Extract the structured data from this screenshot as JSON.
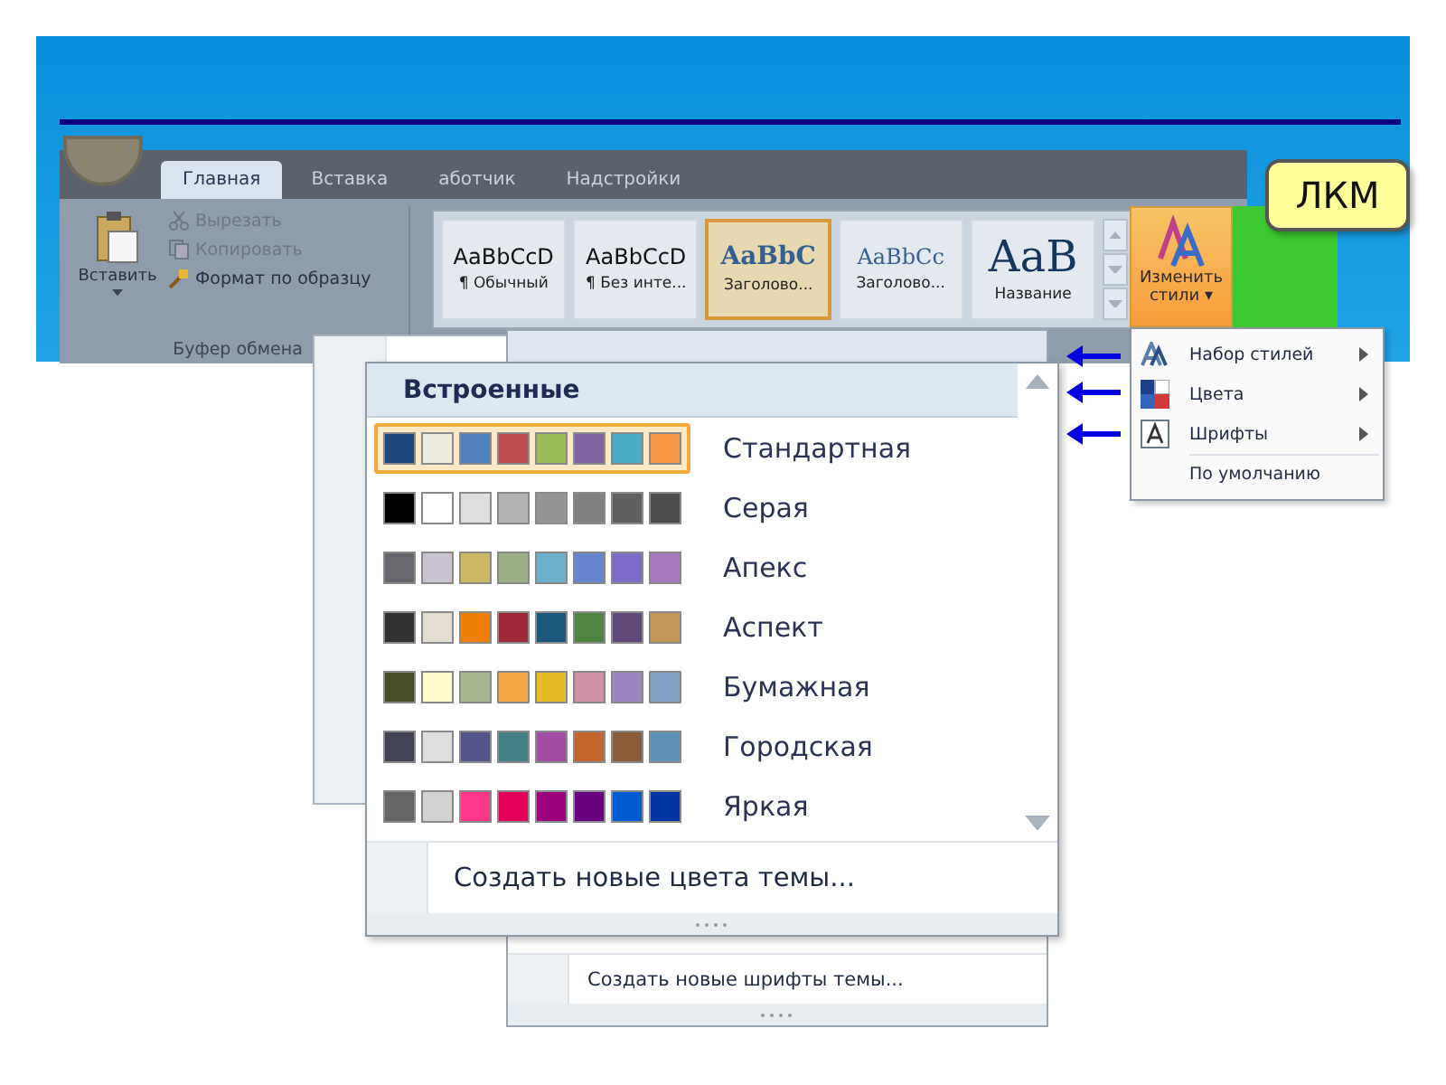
{
  "ribbon": {
    "tabs": [
      {
        "label": "Главная",
        "selected": true
      },
      {
        "label": "Вставка",
        "selected": false
      },
      {
        "label": "аботчик",
        "selected": false
      },
      {
        "label": "Надстройки",
        "selected": false
      }
    ],
    "clipboard": {
      "paste": "Вставить",
      "cut": "Вырезать",
      "copy": "Копировать",
      "format": "Формат по образцу",
      "group": "Буфер обмена"
    },
    "styles": [
      {
        "sample": "AaBbCcD",
        "name": "¶ Обычный",
        "kind": "body",
        "selected": false
      },
      {
        "sample": "AaBbCcD",
        "name": "¶ Без инте...",
        "kind": "body",
        "selected": false
      },
      {
        "sample": "AaBbC",
        "name": "Заголово...",
        "kind": "heading1",
        "selected": true
      },
      {
        "sample": "AaBbCc",
        "name": "Заголово...",
        "kind": "heading2",
        "selected": false
      },
      {
        "sample": "AaB",
        "name": "Название",
        "kind": "title",
        "selected": false
      }
    ],
    "change_styles": {
      "line1": "Изменить",
      "line2": "стили",
      "caret": "▾"
    }
  },
  "callout": "ЛКМ",
  "change_styles_menu": [
    {
      "label": "Набор стилей",
      "submenu": true,
      "kind": "styleset"
    },
    {
      "label": "Цвета",
      "submenu": true,
      "kind": "colors"
    },
    {
      "label": "Шрифты",
      "submenu": true,
      "kind": "fonts"
    },
    {
      "label": "По умолчанию",
      "submenu": false,
      "kind": "plain"
    }
  ],
  "fonts_gallery": {
    "footer": "Создать новые шрифты темы..."
  },
  "colors_gallery": {
    "header": "Встроенные",
    "footer": "Создать новые цвета темы...",
    "schemes": [
      {
        "name": "Стандартная",
        "selected": true,
        "swatches": [
          {
            "color": "#1f497d"
          },
          {
            "color": "#eeece1"
          },
          {
            "color": "#4f81bd"
          },
          {
            "color": "#c0504d"
          },
          {
            "color": "#9bbb59"
          },
          {
            "color": "#8064a2"
          },
          {
            "color": "#4bacc6"
          },
          {
            "color": "#f79646"
          }
        ]
      },
      {
        "name": "Серая",
        "selected": false,
        "swatches": [
          {
            "color": "#000000"
          },
          {
            "color": "#ffffff"
          },
          {
            "color": "#dddddd"
          },
          {
            "color": "#b2b2b2"
          },
          {
            "color": "#969696"
          },
          {
            "color": "#808080"
          },
          {
            "color": "#5f5f5f"
          },
          {
            "color": "#4d4d4d"
          }
        ]
      },
      {
        "name": "Апекс",
        "selected": false,
        "swatches": [
          {
            "color": "#69676d"
          },
          {
            "color": "#c9c2d1"
          },
          {
            "color": "#ceb966"
          },
          {
            "color": "#9cb084"
          },
          {
            "color": "#6bb1c9"
          },
          {
            "color": "#6585cf"
          },
          {
            "color": "#7e6bc9"
          },
          {
            "color": "#a379bb"
          }
        ]
      },
      {
        "name": "Аспект",
        "selected": false,
        "swatches": [
          {
            "color": "#323232"
          },
          {
            "color": "#e3ded1"
          },
          {
            "color": "#f07f09"
          },
          {
            "color": "#9f2936"
          },
          {
            "color": "#1b587c"
          },
          {
            "color": "#4e8542"
          },
          {
            "color": "#604878"
          },
          {
            "color": "#c19859"
          }
        ]
      },
      {
        "name": "Бумажная",
        "selected": false,
        "swatches": [
          {
            "color": "#444d26"
          },
          {
            "color": "#fefac9"
          },
          {
            "color": "#a5b592"
          },
          {
            "color": "#f3a447"
          },
          {
            "color": "#e7bc29"
          },
          {
            "color": "#d092a7"
          },
          {
            "color": "#9c85c0"
          },
          {
            "color": "#809ec2"
          }
        ]
      },
      {
        "name": "Городская",
        "selected": false,
        "swatches": [
          {
            "color": "#424456"
          },
          {
            "color": "#dedede"
          },
          {
            "color": "#53548a"
          },
          {
            "color": "#438086"
          },
          {
            "color": "#a04da3"
          },
          {
            "color": "#c4652d"
          },
          {
            "color": "#8b5d3d"
          },
          {
            "color": "#5c92b5"
          }
        ]
      },
      {
        "name": "Яркая",
        "selected": false,
        "swatches": [
          {
            "color": "#666666"
          },
          {
            "color": "#d2d2d2"
          },
          {
            "color": "#ff388c"
          },
          {
            "color": "#e40059"
          },
          {
            "color": "#9c007f"
          },
          {
            "color": "#68007f"
          },
          {
            "color": "#005bd3"
          },
          {
            "color": "#00349e"
          }
        ]
      }
    ]
  }
}
